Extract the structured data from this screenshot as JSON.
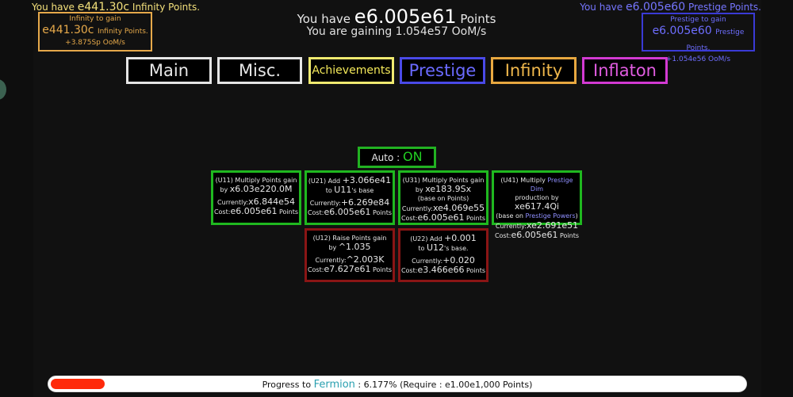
{
  "currencies": {
    "infinity": {
      "prefix": "You have",
      "value": "e441.30c",
      "suffix": "Infinity Points."
    },
    "prestige": {
      "prefix": "You have",
      "value": "e6.005e60",
      "suffix": "Prestige Points."
    }
  },
  "points": {
    "prefix": "You have",
    "value": "e6.005e61",
    "suffix": "Points",
    "gaining": "You are gaining 1.054e57 OoM/s"
  },
  "infinity_gain": {
    "title": "Infinity to gain",
    "value": "e441.30c",
    "unit": "Infinity Points.",
    "rate": "+3.875Sp",
    "rate_unit": "OoM/s"
  },
  "prestige_gain": {
    "title": "Prestige to gain",
    "value": "e6.005e60",
    "unit": "Prestige Points.",
    "rate": "+1.054e56",
    "rate_unit": "OoM/s"
  },
  "tabs": [
    "Main",
    "Misc.",
    "Achievements",
    "Prestige",
    "Infinity",
    "Inflaton"
  ],
  "auto": {
    "label": "Auto :",
    "state": "ON"
  },
  "upgrades": {
    "u11": {
      "id": "(U11)",
      "desc": "Multiply Points gain",
      "by": "by",
      "amount": "x6.03e220.0M",
      "cur_label": "Currently:",
      "cur": "x6.844e54",
      "cost_label": "Cost:",
      "cost": "e6.005e61",
      "cost_unit": "Points"
    },
    "u21": {
      "id": "(U21)",
      "add": "Add",
      "amount": "+3.066e41",
      "to": "to",
      "target": "U11",
      "suffix": "'s base",
      "cur_label": "Currently:",
      "cur": "+6.269e84",
      "cost_label": "Cost:",
      "cost": "e6.005e61",
      "cost_unit": "Points"
    },
    "u31": {
      "id": "(U31)",
      "desc": "Multiply Points gain",
      "by": "by",
      "amount": "xe183.9Sx",
      "note": "(base on Points)",
      "cur_label": "Currently:",
      "cur": "xe4.069e55",
      "cost_label": "Cost:",
      "cost": "e6.005e61",
      "cost_unit": "Points"
    },
    "u41": {
      "id": "(U41)",
      "desc": "Multiply",
      "desc_hl": "Prestige Dim",
      "desc2": "production by",
      "amount": "xe617.4Qi",
      "note_pre": "(base on",
      "note_hl": "Prestige Powers",
      "note_post": ")",
      "cur_label": "Currently:",
      "cur": "xe2.691e51",
      "cost_label": "Cost:",
      "cost": "e6.005e61",
      "cost_unit": "Points"
    },
    "u12": {
      "id": "(U12)",
      "desc": "Raise Points gain",
      "by": "by",
      "amount": "^1.035",
      "cur_label": "Currently:",
      "cur": "^2.003K",
      "cost_label": "Cost:",
      "cost": "e7.627e61",
      "cost_unit": "Points"
    },
    "u22": {
      "id": "(U22)",
      "add": "Add",
      "amount": "+0.001",
      "to": "to",
      "target": "U12",
      "suffix": "'s base.",
      "cur_label": "Currently:",
      "cur": "+0.020",
      "cost_label": "Cost:",
      "cost": "e3.466e66",
      "cost_unit": "Points"
    }
  },
  "progress": {
    "label": "Progress to",
    "target": "Fermion",
    "percent_text": ": 6.177%",
    "require": "(Require : e1.00e1,000 Points)",
    "fraction": 0.06177
  },
  "colors": {
    "infinity": "#e6a94a",
    "prestige": "#4a4ae8",
    "achievements": "#f0ea70",
    "inflaton": "#d23ad2",
    "upgrade_available": "#1fb81f",
    "upgrade_locked": "#8a1515",
    "progress_fill": "#ff2a0a",
    "fermion": "#2aa0b0"
  }
}
